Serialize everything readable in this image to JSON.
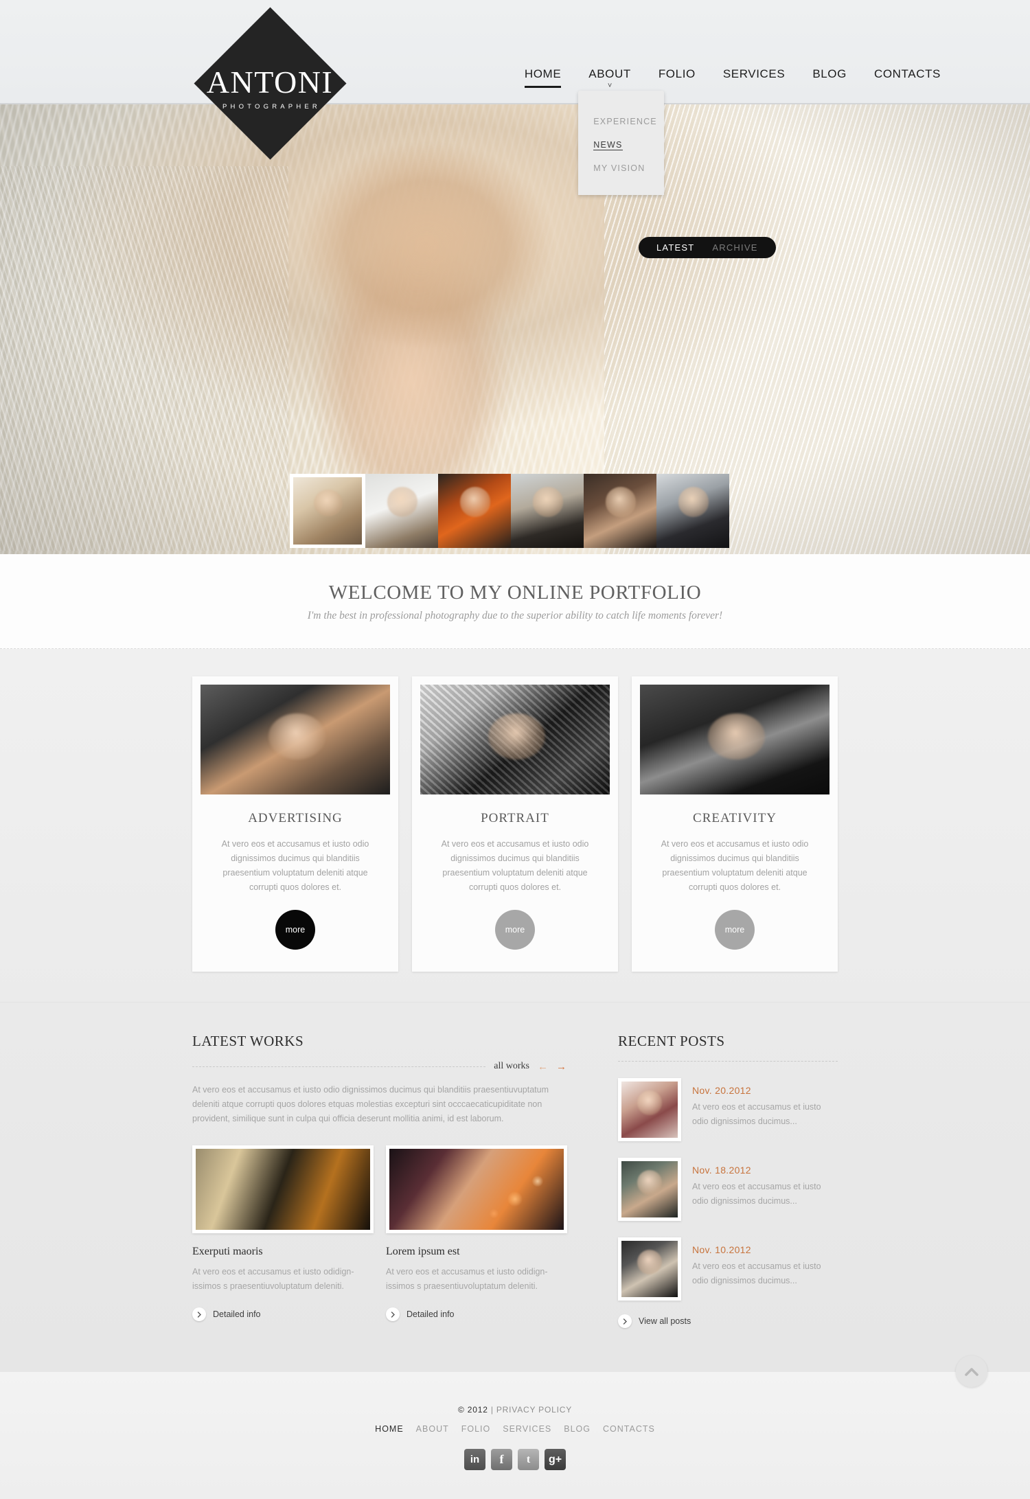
{
  "brand": {
    "name": "ANTONI",
    "tagline": "PHOTOGRAPHER"
  },
  "nav": {
    "items": [
      {
        "label": "HOME",
        "active": true,
        "has_dropdown": false
      },
      {
        "label": "ABOUT",
        "active": false,
        "has_dropdown": true
      },
      {
        "label": "FOLIO",
        "active": false,
        "has_dropdown": false
      },
      {
        "label": "SERVICES",
        "active": false,
        "has_dropdown": false
      },
      {
        "label": "BLOG",
        "active": false,
        "has_dropdown": false
      },
      {
        "label": "CONTACTS",
        "active": false,
        "has_dropdown": false
      }
    ],
    "dropdown": {
      "items": [
        {
          "label": "EXPERIENCE",
          "hover": false
        },
        {
          "label": "NEWS",
          "hover": true
        },
        {
          "label": "MY VISION",
          "hover": false
        }
      ]
    }
  },
  "hero": {
    "toggle": {
      "latest": "LATEST",
      "archive": "ARCHIVE",
      "selected": "LATEST"
    },
    "thumb_count": 6,
    "active_thumb": 1
  },
  "welcome": {
    "heading": "WELCOME TO MY ONLINE PORTFOLIO",
    "subheading": "I'm the best in professional photography due to the superior ability to catch life moments forever!"
  },
  "services": {
    "cards": [
      {
        "title": "ADVERTISING",
        "text": "At vero eos et accusamus et iusto odio dignissimos ducimus qui blanditiis praesentium voluptatum deleniti atque corrupti quos dolores et.",
        "more_label": "more",
        "more_state": "dark"
      },
      {
        "title": "PORTRAIT",
        "text": "At vero eos et accusamus et iusto odio dignissimos ducimus qui blanditiis praesentium voluptatum deleniti atque corrupti quos dolores et.",
        "more_label": "more",
        "more_state": "gray"
      },
      {
        "title": "CREATIVITY",
        "text": "At vero eos et accusamus et iusto odio dignissimos ducimus qui blanditiis praesentium voluptatum deleniti atque corrupti quos dolores et.",
        "more_label": "more",
        "more_state": "gray"
      }
    ]
  },
  "latest_works": {
    "title": "LATEST WORKS",
    "all_works_label": "all works",
    "intro": "At vero eos et accusamus et iusto odio dignissimos ducimus qui blanditiis praesentiuvuptatum deleniti atque corrupti quos dolores etquas molestias excepturi sint occcaecaticupiditate non provident, similique sunt in culpa qui officia deserunt mollitia animi, id est laborum.",
    "items": [
      {
        "title": "Exerputi maoris",
        "text": "At vero eos et accusamus et iusto odidign-issimos s praesentiuvoluptatum deleniti.",
        "link_label": "Detailed info"
      },
      {
        "title": "Lorem ipsum est",
        "text": "At vero eos et accusamus et iusto odidign-issimos s praesentiuvoluptatum deleniti.",
        "link_label": "Detailed info"
      }
    ]
  },
  "recent_posts": {
    "title": "RECENT POSTS",
    "posts": [
      {
        "date": "Nov. 20.2012",
        "excerpt": "At vero eos et accusamus et iusto odio dignissimos ducimus..."
      },
      {
        "date": "Nov. 18.2012",
        "excerpt": "At vero eos et accusamus et iusto odio dignissimos ducimus..."
      },
      {
        "date": "Nov. 10.2012",
        "excerpt": "At vero eos et accusamus et iusto odio dignissimos ducimus..."
      }
    ],
    "view_all_label": "View all posts"
  },
  "footer": {
    "copyright_year": "© 2012",
    "separator": "|",
    "privacy_label": "PRIVACY POLICY",
    "nav": [
      {
        "label": "HOME",
        "active": true
      },
      {
        "label": "ABOUT",
        "active": false
      },
      {
        "label": "FOLIO",
        "active": false
      },
      {
        "label": "SERVICES",
        "active": false
      },
      {
        "label": "BLOG",
        "active": false
      },
      {
        "label": "CONTACTS",
        "active": false
      }
    ],
    "socials": [
      {
        "name": "linkedin",
        "glyph": "in"
      },
      {
        "name": "facebook",
        "glyph": "f"
      },
      {
        "name": "twitter",
        "glyph": "t"
      },
      {
        "name": "googleplus",
        "glyph": "g+"
      }
    ]
  },
  "colors": {
    "accent_orange": "#c7733c",
    "dark": "#1a1a1a",
    "muted": "#a6a6a6"
  }
}
